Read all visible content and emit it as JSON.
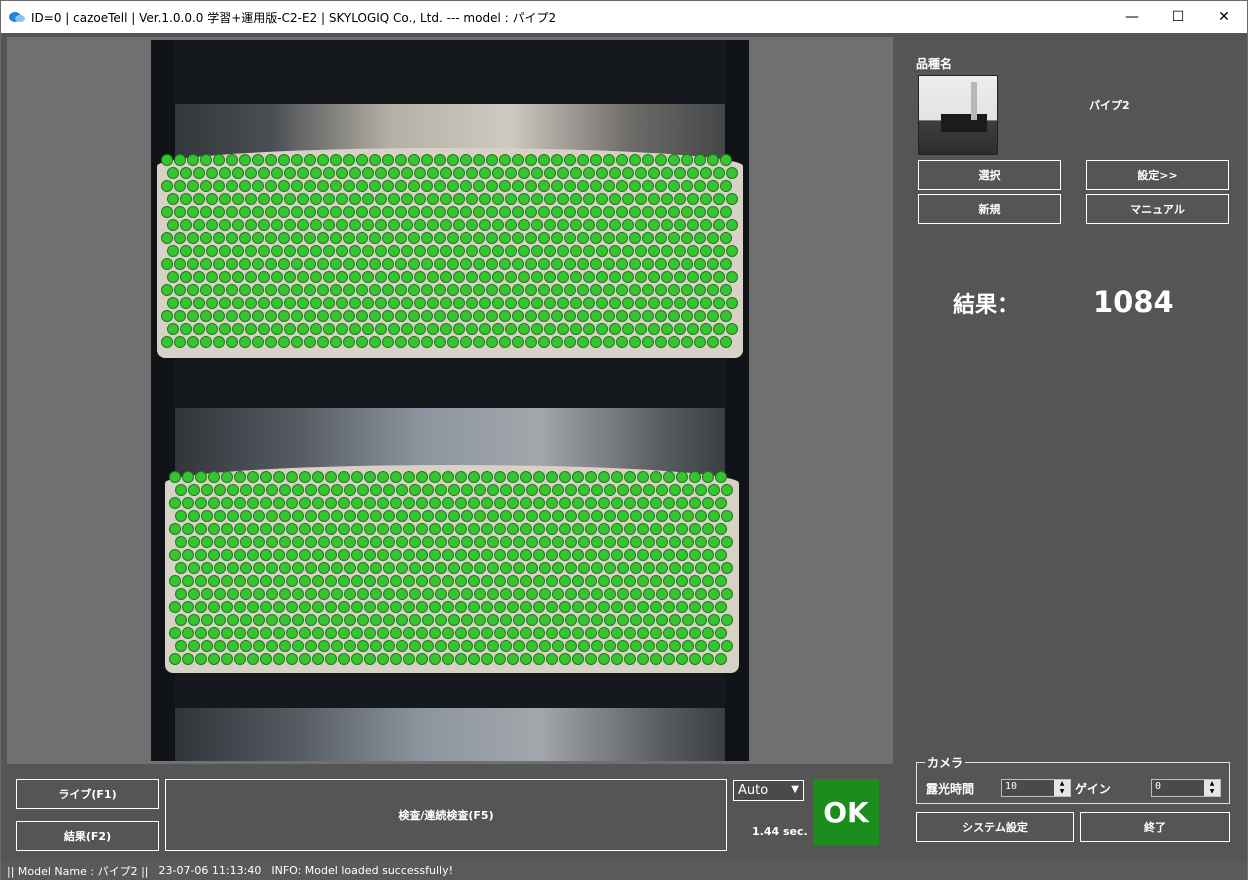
{
  "window": {
    "title": "ID=0 | cazoeTell | Ver.1.0.0.0 学習+運用版-C2-E2 | SKYLOGIQ Co., Ltd. --- model : パイプ2",
    "minimize": "—",
    "maximize": "☐",
    "close": "✕"
  },
  "right": {
    "product_label": "品種名",
    "product_name": "パイプ2",
    "select_btn": "選択",
    "settings_btn": "設定>>",
    "new_btn": "新規",
    "manual_btn": "マニュアル",
    "result_label": "結果：",
    "result_value": "1084"
  },
  "camera": {
    "title": "カメラ",
    "exposure_label": "露光時間",
    "exposure_value": "10",
    "gain_label": "ゲイン",
    "gain_value": "0",
    "system_btn": "システム設定",
    "exit_btn": "終了"
  },
  "bottom": {
    "live_btn": "ライブ(F1)",
    "result_btn": "結果(F2)",
    "inspect_btn": "検査/連続検査(F5)",
    "mode_value": "Auto",
    "time": "1.44 sec.",
    "judge": "OK"
  },
  "colors": {
    "ok": "#1c8c1c",
    "detect": "#36c430",
    "background": "#555555"
  },
  "status": {
    "model": "|| Model Name : パイプ2 ||",
    "timestamp": "23-07-06 11:13:40",
    "message": "INFO:   Model loaded successfully!"
  }
}
